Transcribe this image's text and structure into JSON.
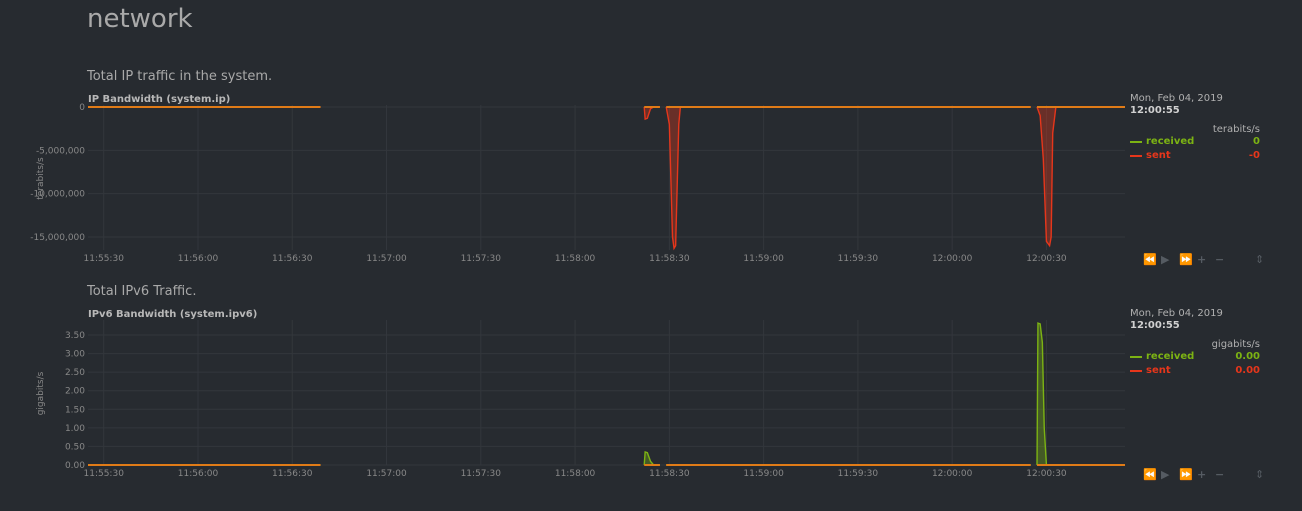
{
  "page": {
    "title": "network"
  },
  "colors": {
    "received": "#7cb313",
    "sent": "#e6361b",
    "baseline": "#e07b17",
    "grid": "#33373c",
    "axis": "#888888"
  },
  "toolbar_icons": [
    "rewind-icon",
    "play-icon",
    "fast-forward-icon",
    "zoom-in-icon",
    "zoom-out-icon",
    "resize-handle-icon"
  ],
  "chart_data": [
    {
      "type": "area",
      "description": "Total IP traffic in the system.",
      "title": "IP Bandwidth (system.ip)",
      "ylabel": "terabits/s",
      "ylim": [
        -16500000,
        0
      ],
      "yticks": [
        0,
        -5000000,
        -10000000,
        -15000000
      ],
      "ytick_labels": [
        "0",
        "-5,000,000",
        "-10,000,000",
        "-15,000,000"
      ],
      "xlim": [
        "11:55:25",
        "12:00:55"
      ],
      "xticks": [
        "11:55:30",
        "11:56:00",
        "11:56:30",
        "11:57:00",
        "11:57:30",
        "11:58:00",
        "11:58:30",
        "11:59:00",
        "11:59:30",
        "12:00:00",
        "12:00:30"
      ],
      "gaps": [
        [
          "11:56:39",
          "11:58:22"
        ],
        [
          "11:58:27",
          "11:58:29"
        ],
        [
          "12:00:25",
          "12:00:27"
        ]
      ],
      "series": [
        {
          "name": "received",
          "points": [
            [
              "11:55:25",
              0
            ],
            [
              "12:00:55",
              0
            ]
          ]
        },
        {
          "name": "sent",
          "points": [
            [
              "11:55:25",
              0
            ],
            [
              "11:56:39",
              0
            ],
            [
              "11:58:22",
              0
            ],
            [
              "11:58:22.3",
              -1400000
            ],
            [
              "11:58:23",
              -1300000
            ],
            [
              "11:58:24",
              -200000
            ],
            [
              "11:58:25",
              0
            ],
            [
              "11:58:27",
              0
            ],
            [
              "11:58:29",
              0
            ],
            [
              "11:58:30",
              -2000000
            ],
            [
              "11:58:31",
              -15000000
            ],
            [
              "11:58:31.5",
              -16300000
            ],
            [
              "11:58:32",
              -16000000
            ],
            [
              "11:58:33",
              -2000000
            ],
            [
              "11:58:33.5",
              0
            ],
            [
              "12:00:25",
              0
            ],
            [
              "12:00:27",
              0
            ],
            [
              "12:00:28",
              -1000000
            ],
            [
              "12:00:29",
              -6000000
            ],
            [
              "12:00:30",
              -15500000
            ],
            [
              "12:00:31",
              -16000000
            ],
            [
              "12:00:31.5",
              -15000000
            ],
            [
              "12:00:32",
              -3000000
            ],
            [
              "12:00:33",
              0
            ],
            [
              "12:00:55",
              0
            ]
          ]
        }
      ],
      "legend": {
        "date": "Mon, Feb 04, 2019",
        "time": "12:00:55",
        "units": "terabits/s",
        "entries": [
          {
            "name": "received",
            "value": "0"
          },
          {
            "name": "sent",
            "value": "-0"
          }
        ]
      }
    },
    {
      "type": "area",
      "description": "Total IPv6 Traffic.",
      "title": "IPv6 Bandwidth (system.ipv6)",
      "ylabel": "gigabits/s",
      "ylim": [
        0,
        3.85
      ],
      "yticks": [
        0,
        0.5,
        1.0,
        1.5,
        2.0,
        2.5,
        3.0,
        3.5
      ],
      "ytick_labels": [
        "0.00",
        "0.50",
        "1.00",
        "1.50",
        "2.00",
        "2.50",
        "3.00",
        "3.50"
      ],
      "xlim": [
        "11:55:25",
        "12:00:55"
      ],
      "xticks": [
        "11:55:30",
        "11:56:00",
        "11:56:30",
        "11:57:00",
        "11:57:30",
        "11:58:00",
        "11:58:30",
        "11:59:00",
        "11:59:30",
        "12:00:00",
        "12:00:30"
      ],
      "gaps": [
        [
          "11:56:39",
          "11:58:22"
        ],
        [
          "11:58:27",
          "11:58:29"
        ],
        [
          "12:00:25",
          "12:00:27"
        ]
      ],
      "series": [
        {
          "name": "received",
          "points": [
            [
              "11:55:25",
              0
            ],
            [
              "11:56:39",
              0
            ],
            [
              "11:58:22",
              0
            ],
            [
              "11:58:22.3",
              0.35
            ],
            [
              "11:58:23",
              0.33
            ],
            [
              "11:58:24",
              0.1
            ],
            [
              "11:58:25",
              0
            ],
            [
              "11:58:27",
              0
            ],
            [
              "11:58:29",
              0
            ],
            [
              "12:00:25",
              0
            ],
            [
              "12:00:27",
              0
            ],
            [
              "12:00:27.3",
              3.82
            ],
            [
              "12:00:28",
              3.8
            ],
            [
              "12:00:28.7",
              3.3
            ],
            [
              "12:00:29.3",
              1.0
            ],
            [
              "12:00:30",
              0
            ],
            [
              "12:00:55",
              0
            ]
          ]
        },
        {
          "name": "sent",
          "points": [
            [
              "11:55:25",
              0
            ],
            [
              "12:00:55",
              0
            ]
          ]
        }
      ],
      "legend": {
        "date": "Mon, Feb 04, 2019",
        "time": "12:00:55",
        "units": "gigabits/s",
        "entries": [
          {
            "name": "received",
            "value": "0.00"
          },
          {
            "name": "sent",
            "value": "0.00"
          }
        ]
      }
    }
  ]
}
